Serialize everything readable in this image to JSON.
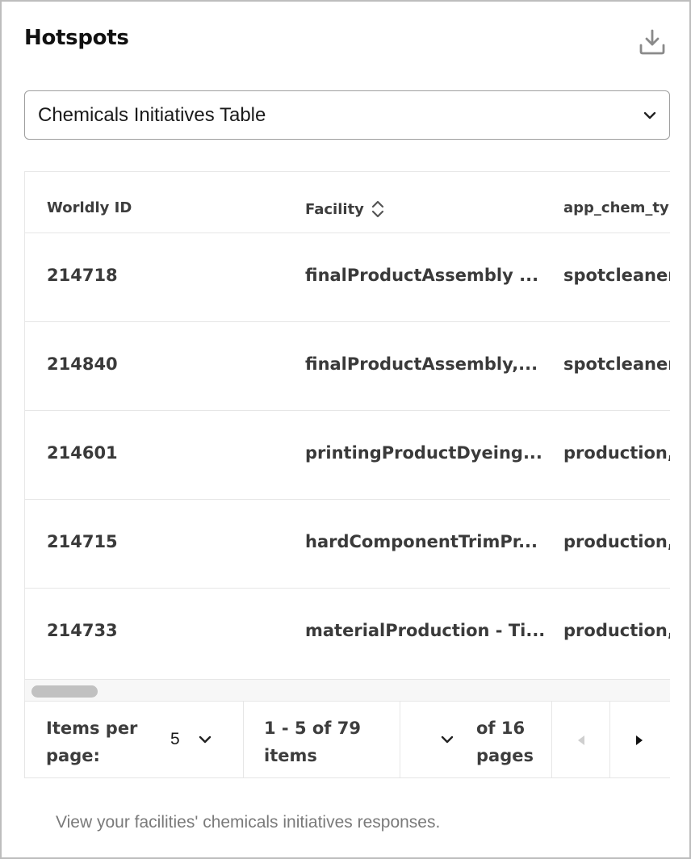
{
  "header": {
    "title": "Hotspots",
    "download_icon": "download-icon"
  },
  "view_select": {
    "selected": "Chemicals Initiatives Table",
    "icon": "chevron-down-icon"
  },
  "table": {
    "columns": [
      {
        "label": "Worldly ID",
        "sortable": false
      },
      {
        "label": "Facility",
        "sortable": true,
        "sort_icon": "sort-icon"
      },
      {
        "label": "app_chem_typ",
        "sortable": false
      }
    ],
    "rows": [
      {
        "id": "214718",
        "facility": "finalProductAssembly ...",
        "chem_type": "spotcleaner,"
      },
      {
        "id": "214840",
        "facility": "finalProductAssembly,...",
        "chem_type": "spotcleaner"
      },
      {
        "id": "214601",
        "facility": "printingProductDyeing...",
        "chem_type": "production,c"
      },
      {
        "id": "214715",
        "facility": "hardComponentTrimPr...",
        "chem_type": "production,c"
      },
      {
        "id": "214733",
        "facility": "materialProduction - Ti...",
        "chem_type": "production,c"
      }
    ]
  },
  "pagination": {
    "items_per_page_label": "Items per page:",
    "items_per_page_value": "5",
    "range_text": "1 - 5 of 79 items",
    "pages_text": "of 16 pages",
    "prev_icon": "caret-left-icon",
    "next_icon": "caret-right-icon"
  },
  "footer": {
    "description": "View your facilities' chemicals initiatives responses."
  }
}
